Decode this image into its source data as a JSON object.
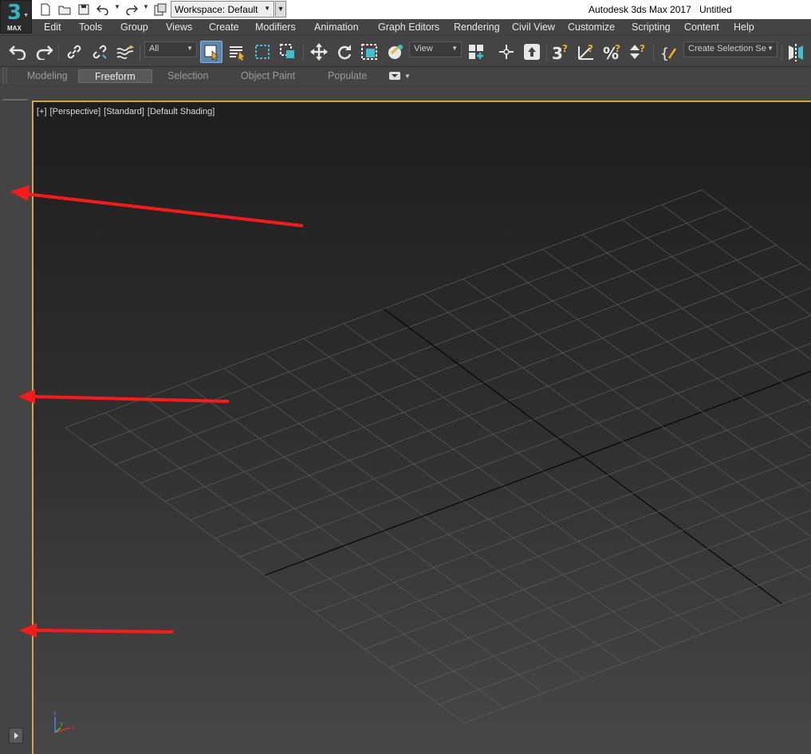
{
  "app": {
    "logo_number": "3",
    "logo_label": "MAX",
    "title": "Autodesk 3ds Max 2017",
    "document": "Untitled",
    "workspace": "Workspace: Default"
  },
  "menu": [
    "Edit",
    "Tools",
    "Group",
    "Views",
    "Create",
    "Modifiers",
    "Animation",
    "Graph Editors",
    "Rendering",
    "Civil View",
    "Customize",
    "Scripting",
    "Content",
    "Help"
  ],
  "toolbar": {
    "filter_value": "All",
    "coord_value": "View",
    "named_selection_value": "Create Selection Se"
  },
  "ribbon_tabs": [
    "Modeling",
    "Freeform",
    "Selection",
    "Object Paint",
    "Populate"
  ],
  "active_ribbon_tab": "Freeform",
  "viewport": {
    "label_plus": "[+]",
    "label_view": "[Perspective]",
    "label_mode": "[Standard]",
    "label_shading": "[Default Shading]",
    "axis_x": "x",
    "axis_y": "y",
    "axis_z": "z"
  },
  "colors": {
    "viewport_border": "#d4a73a",
    "annotation_arrow": "#ff1a1a",
    "active_tool": "#5c86b4",
    "logo_accent": "#2fb6c0"
  }
}
